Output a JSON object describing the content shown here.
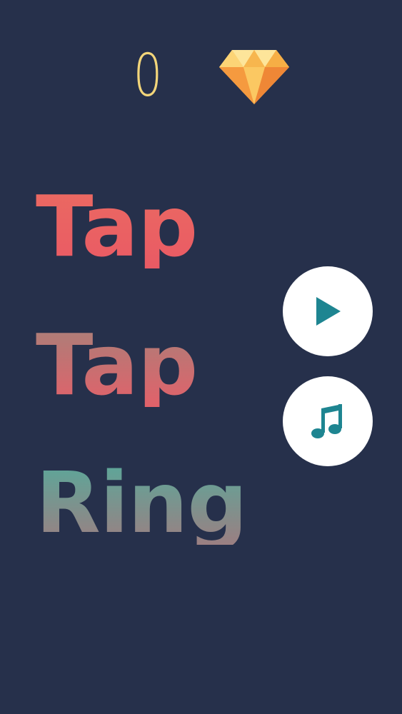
{
  "hud": {
    "score": "0",
    "gem_icon": "diamond-icon"
  },
  "title": {
    "line1": "Tap",
    "line2": "Tap",
    "line3": "Ring"
  },
  "buttons": {
    "play_icon": "play-icon",
    "music_icon": "music-note-icon"
  },
  "colors": {
    "background": "#26304b",
    "score": "#f2d57a",
    "gem_light": "#fbd071",
    "gem_dark": "#f08b3a",
    "button_bg": "#ffffff",
    "button_icon": "#1e8591",
    "title_red": "#eb6363",
    "title_teal": "#5aa89a"
  }
}
